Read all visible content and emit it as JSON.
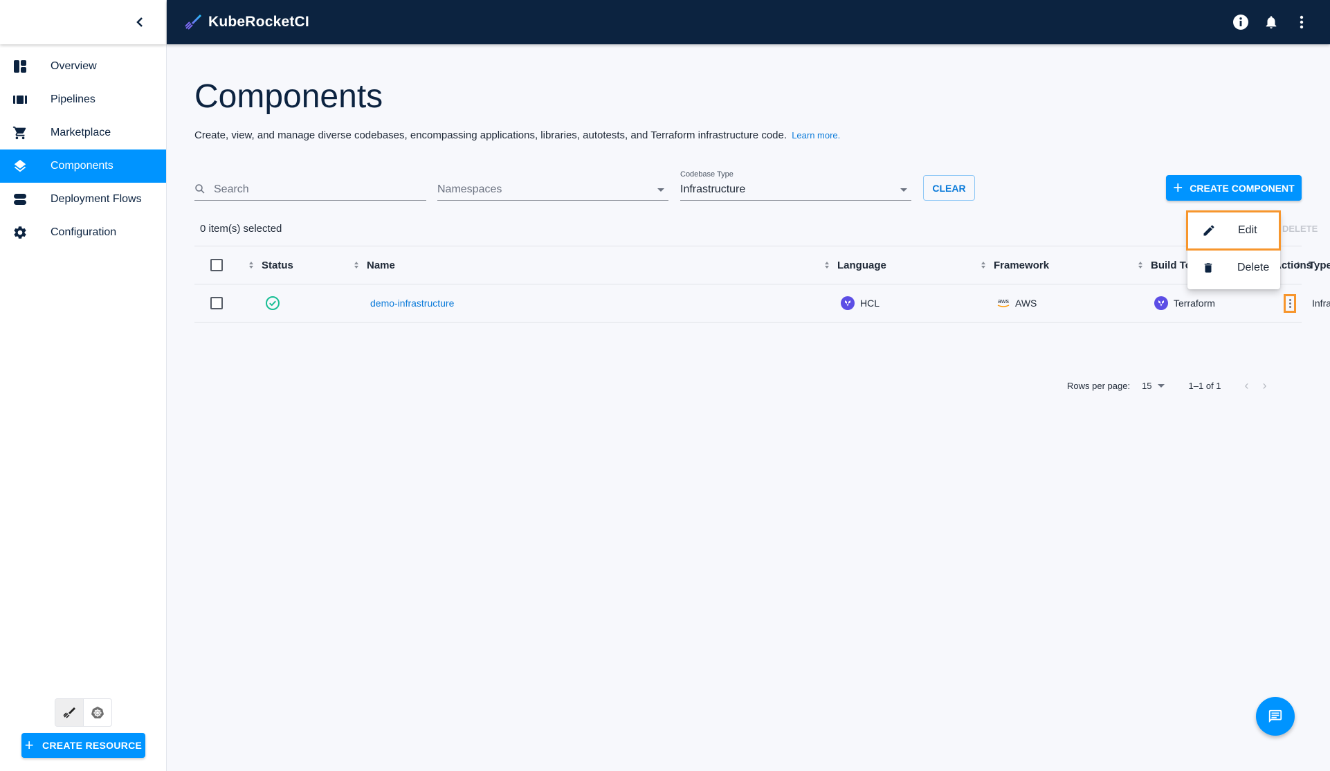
{
  "app": {
    "title": "KubeRocketCI"
  },
  "topbar": {
    "icons": [
      "info-icon",
      "bell-icon",
      "more-vert-icon"
    ]
  },
  "sidebar": {
    "items": [
      {
        "label": "Overview",
        "icon": "dashboard-icon",
        "active": false
      },
      {
        "label": "Pipelines",
        "icon": "pipelines-icon",
        "active": false
      },
      {
        "label": "Marketplace",
        "icon": "cart-icon",
        "active": false
      },
      {
        "label": "Components",
        "icon": "layers-icon",
        "active": true
      },
      {
        "label": "Deployment Flows",
        "icon": "flows-icon",
        "active": false
      },
      {
        "label": "Configuration",
        "icon": "gear-icon",
        "active": false
      }
    ],
    "create_resource_label": "CREATE RESOURCE"
  },
  "page": {
    "title": "Components",
    "description": "Create, view, and manage diverse codebases, encompassing applications, libraries, autotests, and Terraform infrastructure code.",
    "learn_more": "Learn more."
  },
  "filters": {
    "search_placeholder": "Search",
    "namespaces_placeholder": "Namespaces",
    "codebase_type_label": "Codebase Type",
    "codebase_type_value": "Infrastructure",
    "clear_label": "CLEAR",
    "create_label": "CREATE COMPONENT"
  },
  "selection": {
    "count_text": "0 item(s) selected",
    "delete_label": "DELETE"
  },
  "table": {
    "columns": [
      "Status",
      "Name",
      "Language",
      "Framework",
      "Build Tool",
      "Type",
      "Actions"
    ],
    "rows": [
      {
        "status": "ok",
        "name": "demo-infrastructure",
        "language": "HCL",
        "framework": "AWS",
        "build_tool": "Terraform",
        "type": "Infrastructure"
      }
    ]
  },
  "pagination": {
    "rows_per_page_label": "Rows per page:",
    "rows_per_page": "15",
    "range": "1–1 of 1"
  },
  "menu": {
    "edit_label": "Edit",
    "delete_label": "Delete"
  },
  "colors": {
    "accent": "#0094ff",
    "topbar": "#0c2340",
    "highlight": "#f7962d",
    "status_ok": "#18be94",
    "terraform": "#5c4ee5"
  }
}
